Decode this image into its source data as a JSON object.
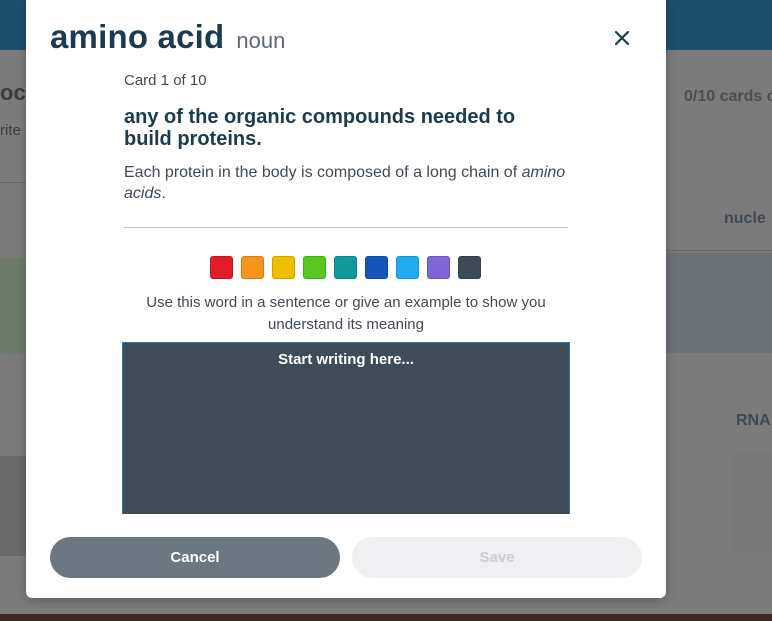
{
  "background": {
    "left_title": "oc",
    "left_sub": "rite",
    "progress": "0/10 cards c",
    "term_nucleotide": "nucle",
    "term_rna": "RNA"
  },
  "modal": {
    "word": "amino acid",
    "part_of_speech": "noun",
    "close_icon": "close-icon",
    "card_counter": "Card 1 of 10",
    "definition": "any of the organic compounds needed to build proteins.",
    "example_prefix": "Each protein in the body is composed of a long chain of ",
    "example_emphasis": "amino acids",
    "example_suffix": ".",
    "color_swatches": [
      {
        "name": "red",
        "hex": "#e31c26"
      },
      {
        "name": "orange",
        "hex": "#f7941d"
      },
      {
        "name": "yellow",
        "hex": "#f0c000"
      },
      {
        "name": "green",
        "hex": "#57c81f"
      },
      {
        "name": "teal",
        "hex": "#11999e"
      },
      {
        "name": "blue",
        "hex": "#1456b8"
      },
      {
        "name": "sky",
        "hex": "#22aaef"
      },
      {
        "name": "purple",
        "hex": "#7e66d6"
      },
      {
        "name": "slate",
        "hex": "#3d4a57"
      }
    ],
    "prompt": "Use this word in a sentence or give an example to show you understand its meaning",
    "editor_placeholder": "Start writing here...",
    "cancel_label": "Cancel",
    "save_label": "Save"
  }
}
